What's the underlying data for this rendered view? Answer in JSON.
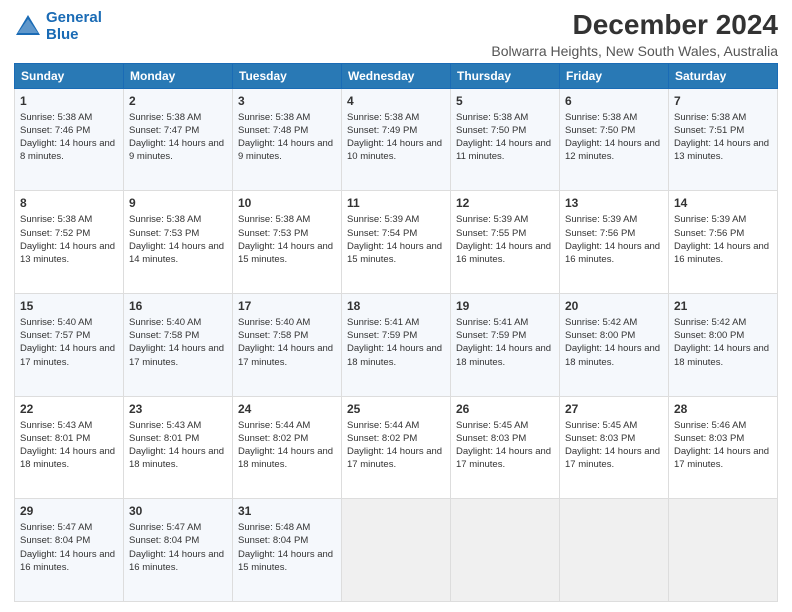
{
  "logo": {
    "line1": "General",
    "line2": "Blue"
  },
  "title": "December 2024",
  "subtitle": "Bolwarra Heights, New South Wales, Australia",
  "headers": [
    "Sunday",
    "Monday",
    "Tuesday",
    "Wednesday",
    "Thursday",
    "Friday",
    "Saturday"
  ],
  "weeks": [
    [
      {
        "day": "1",
        "sunrise": "5:38 AM",
        "sunset": "7:46 PM",
        "daylight": "14 hours and 8 minutes."
      },
      {
        "day": "2",
        "sunrise": "5:38 AM",
        "sunset": "7:47 PM",
        "daylight": "14 hours and 9 minutes."
      },
      {
        "day": "3",
        "sunrise": "5:38 AM",
        "sunset": "7:48 PM",
        "daylight": "14 hours and 9 minutes."
      },
      {
        "day": "4",
        "sunrise": "5:38 AM",
        "sunset": "7:49 PM",
        "daylight": "14 hours and 10 minutes."
      },
      {
        "day": "5",
        "sunrise": "5:38 AM",
        "sunset": "7:50 PM",
        "daylight": "14 hours and 11 minutes."
      },
      {
        "day": "6",
        "sunrise": "5:38 AM",
        "sunset": "7:50 PM",
        "daylight": "14 hours and 12 minutes."
      },
      {
        "day": "7",
        "sunrise": "5:38 AM",
        "sunset": "7:51 PM",
        "daylight": "14 hours and 13 minutes."
      }
    ],
    [
      {
        "day": "8",
        "sunrise": "5:38 AM",
        "sunset": "7:52 PM",
        "daylight": "14 hours and 13 minutes."
      },
      {
        "day": "9",
        "sunrise": "5:38 AM",
        "sunset": "7:53 PM",
        "daylight": "14 hours and 14 minutes."
      },
      {
        "day": "10",
        "sunrise": "5:38 AM",
        "sunset": "7:53 PM",
        "daylight": "14 hours and 15 minutes."
      },
      {
        "day": "11",
        "sunrise": "5:39 AM",
        "sunset": "7:54 PM",
        "daylight": "14 hours and 15 minutes."
      },
      {
        "day": "12",
        "sunrise": "5:39 AM",
        "sunset": "7:55 PM",
        "daylight": "14 hours and 16 minutes."
      },
      {
        "day": "13",
        "sunrise": "5:39 AM",
        "sunset": "7:56 PM",
        "daylight": "14 hours and 16 minutes."
      },
      {
        "day": "14",
        "sunrise": "5:39 AM",
        "sunset": "7:56 PM",
        "daylight": "14 hours and 16 minutes."
      }
    ],
    [
      {
        "day": "15",
        "sunrise": "5:40 AM",
        "sunset": "7:57 PM",
        "daylight": "14 hours and 17 minutes."
      },
      {
        "day": "16",
        "sunrise": "5:40 AM",
        "sunset": "7:58 PM",
        "daylight": "14 hours and 17 minutes."
      },
      {
        "day": "17",
        "sunrise": "5:40 AM",
        "sunset": "7:58 PM",
        "daylight": "14 hours and 17 minutes."
      },
      {
        "day": "18",
        "sunrise": "5:41 AM",
        "sunset": "7:59 PM",
        "daylight": "14 hours and 18 minutes."
      },
      {
        "day": "19",
        "sunrise": "5:41 AM",
        "sunset": "7:59 PM",
        "daylight": "14 hours and 18 minutes."
      },
      {
        "day": "20",
        "sunrise": "5:42 AM",
        "sunset": "8:00 PM",
        "daylight": "14 hours and 18 minutes."
      },
      {
        "day": "21",
        "sunrise": "5:42 AM",
        "sunset": "8:00 PM",
        "daylight": "14 hours and 18 minutes."
      }
    ],
    [
      {
        "day": "22",
        "sunrise": "5:43 AM",
        "sunset": "8:01 PM",
        "daylight": "14 hours and 18 minutes."
      },
      {
        "day": "23",
        "sunrise": "5:43 AM",
        "sunset": "8:01 PM",
        "daylight": "14 hours and 18 minutes."
      },
      {
        "day": "24",
        "sunrise": "5:44 AM",
        "sunset": "8:02 PM",
        "daylight": "14 hours and 18 minutes."
      },
      {
        "day": "25",
        "sunrise": "5:44 AM",
        "sunset": "8:02 PM",
        "daylight": "14 hours and 17 minutes."
      },
      {
        "day": "26",
        "sunrise": "5:45 AM",
        "sunset": "8:03 PM",
        "daylight": "14 hours and 17 minutes."
      },
      {
        "day": "27",
        "sunrise": "5:45 AM",
        "sunset": "8:03 PM",
        "daylight": "14 hours and 17 minutes."
      },
      {
        "day": "28",
        "sunrise": "5:46 AM",
        "sunset": "8:03 PM",
        "daylight": "14 hours and 17 minutes."
      }
    ],
    [
      {
        "day": "29",
        "sunrise": "5:47 AM",
        "sunset": "8:04 PM",
        "daylight": "14 hours and 16 minutes."
      },
      {
        "day": "30",
        "sunrise": "5:47 AM",
        "sunset": "8:04 PM",
        "daylight": "14 hours and 16 minutes."
      },
      {
        "day": "31",
        "sunrise": "5:48 AM",
        "sunset": "8:04 PM",
        "daylight": "14 hours and 15 minutes."
      },
      null,
      null,
      null,
      null
    ]
  ]
}
